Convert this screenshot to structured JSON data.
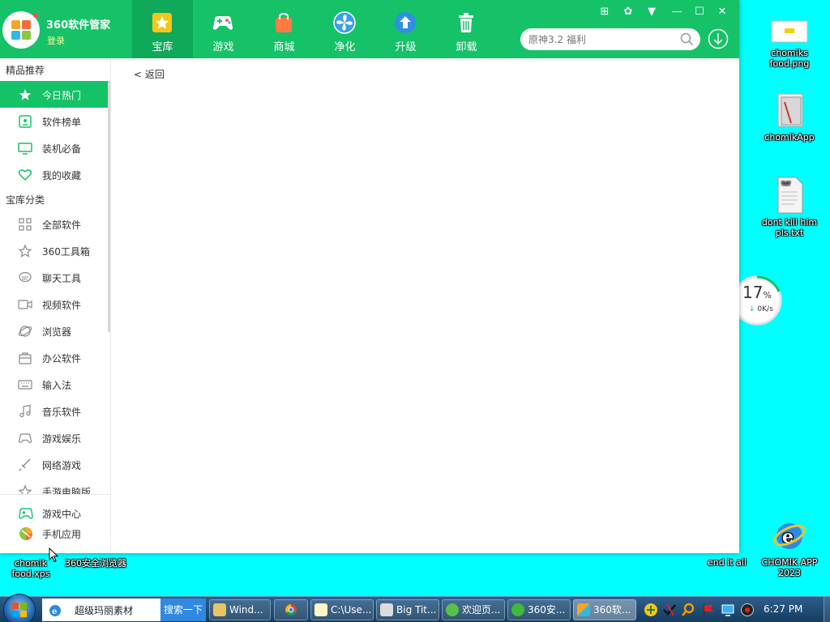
{
  "app": {
    "name": "360软件管家",
    "login": "登录",
    "nav": [
      "宝库",
      "游戏",
      "商城",
      "净化",
      "升级",
      "卸载"
    ],
    "search_placeholder": "原神3.2 福利",
    "back": "< 返回"
  },
  "sidebar": {
    "section1": "精品推荐",
    "items1": [
      "今日热门",
      "软件榜单",
      "装机必备",
      "我的收藏"
    ],
    "section2": "宝库分类",
    "items2": [
      "全部软件",
      "360工具箱",
      "聊天工具",
      "视频软件",
      "浏览器",
      "办公软件",
      "输入法",
      "音乐软件",
      "游戏娱乐",
      "网络游戏",
      "手游电脑版"
    ],
    "bottom": [
      "游戏中心",
      "手机应用"
    ]
  },
  "speed_widget": {
    "percent": "17",
    "percent_unit": "%",
    "rate": "0K/s"
  },
  "desktop": {
    "icons_right": [
      "chomiks food.png",
      "chomikApp",
      "dont kill him pls.txt"
    ],
    "ie_icon": "CHOMIK APP 2023",
    "bottom_left": [
      "chomik food.xps",
      "360安全浏览器"
    ],
    "end_it_all": "end it all"
  },
  "taskbar": {
    "browser_tab": "超级玛丽素材",
    "search_btn": "搜索一下",
    "buttons": [
      "Wind...",
      "C:\\Use...",
      "Big Tit...",
      "欢迎页...",
      "360安...",
      "360软..."
    ],
    "clock": "6:27 PM"
  },
  "colors": {
    "accent": "#15c268",
    "accent_dark": "#10a95a",
    "desktop": "#00ffff"
  }
}
